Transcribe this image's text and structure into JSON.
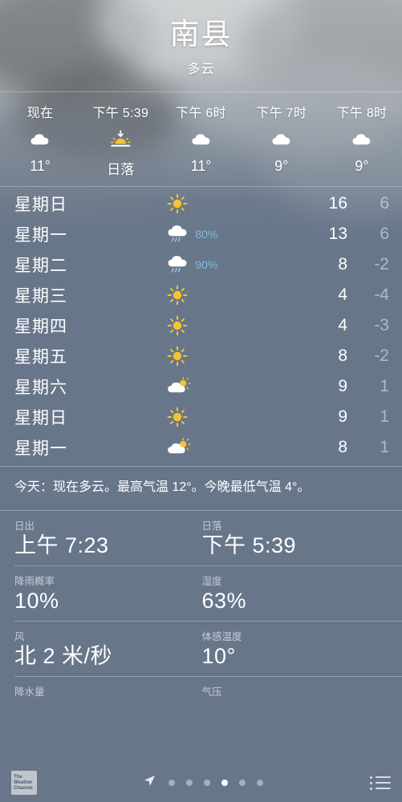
{
  "header": {
    "city": "南县",
    "condition": "多云"
  },
  "hourly": [
    {
      "label": "现在",
      "icon": "cloud-icon",
      "temp": "11°",
      "is_word": false
    },
    {
      "label": "下午 5:39",
      "icon": "sunset-icon",
      "temp": "日落",
      "is_word": true
    },
    {
      "label": "下午 6时",
      "icon": "cloud-icon",
      "temp": "11°",
      "is_word": false
    },
    {
      "label": "下午 7时",
      "icon": "cloud-icon",
      "temp": "9°",
      "is_word": false
    },
    {
      "label": "下午 8时",
      "icon": "cloud-icon",
      "temp": "9°",
      "is_word": false
    }
  ],
  "daily": [
    {
      "day": "星期日",
      "icon": "sun-icon",
      "pop": "",
      "high": "16",
      "low": "6"
    },
    {
      "day": "星期一",
      "icon": "rain-icon",
      "pop": "80%",
      "high": "13",
      "low": "6"
    },
    {
      "day": "星期二",
      "icon": "rain-icon",
      "pop": "90%",
      "high": "8",
      "low": "-2"
    },
    {
      "day": "星期三",
      "icon": "sun-icon",
      "pop": "",
      "high": "4",
      "low": "-4"
    },
    {
      "day": "星期四",
      "icon": "sun-icon",
      "pop": "",
      "high": "4",
      "low": "-3"
    },
    {
      "day": "星期五",
      "icon": "sun-icon",
      "pop": "",
      "high": "8",
      "low": "-2"
    },
    {
      "day": "星期六",
      "icon": "partly-cloudy-icon",
      "pop": "",
      "high": "9",
      "low": "1"
    },
    {
      "day": "星期日",
      "icon": "sun-icon",
      "pop": "",
      "high": "9",
      "low": "1"
    },
    {
      "day": "星期一",
      "icon": "partly-cloudy-icon",
      "pop": "",
      "high": "8",
      "low": "1"
    }
  ],
  "summary": "今天：现在多云。最高气温 12°。今晚最低气温 4°。",
  "details": [
    [
      {
        "label": "日出",
        "value": "上午 7:23"
      },
      {
        "label": "日落",
        "value": "下午 5:39"
      }
    ],
    [
      {
        "label": "降雨概率",
        "value": "10%"
      },
      {
        "label": "湿度",
        "value": "63%"
      }
    ],
    [
      {
        "label": "风",
        "value": "北 2 米/秒"
      },
      {
        "label": "体感温度",
        "value": "10°"
      }
    ],
    [
      {
        "label": "降水量",
        "value": ""
      },
      {
        "label": "气压",
        "value": ""
      }
    ]
  ],
  "bottom_bar": {
    "logo_lines": [
      "The",
      "Weather",
      "Channel"
    ],
    "page_count": 6,
    "active_page": 4
  },
  "colors": {
    "precip_blue": "#7fb9e0",
    "sun_yellow": "#f5c432",
    "panel_blue_gray": "#67768a",
    "low_temp_gray": "rgba(255,255,255,0.48)"
  }
}
